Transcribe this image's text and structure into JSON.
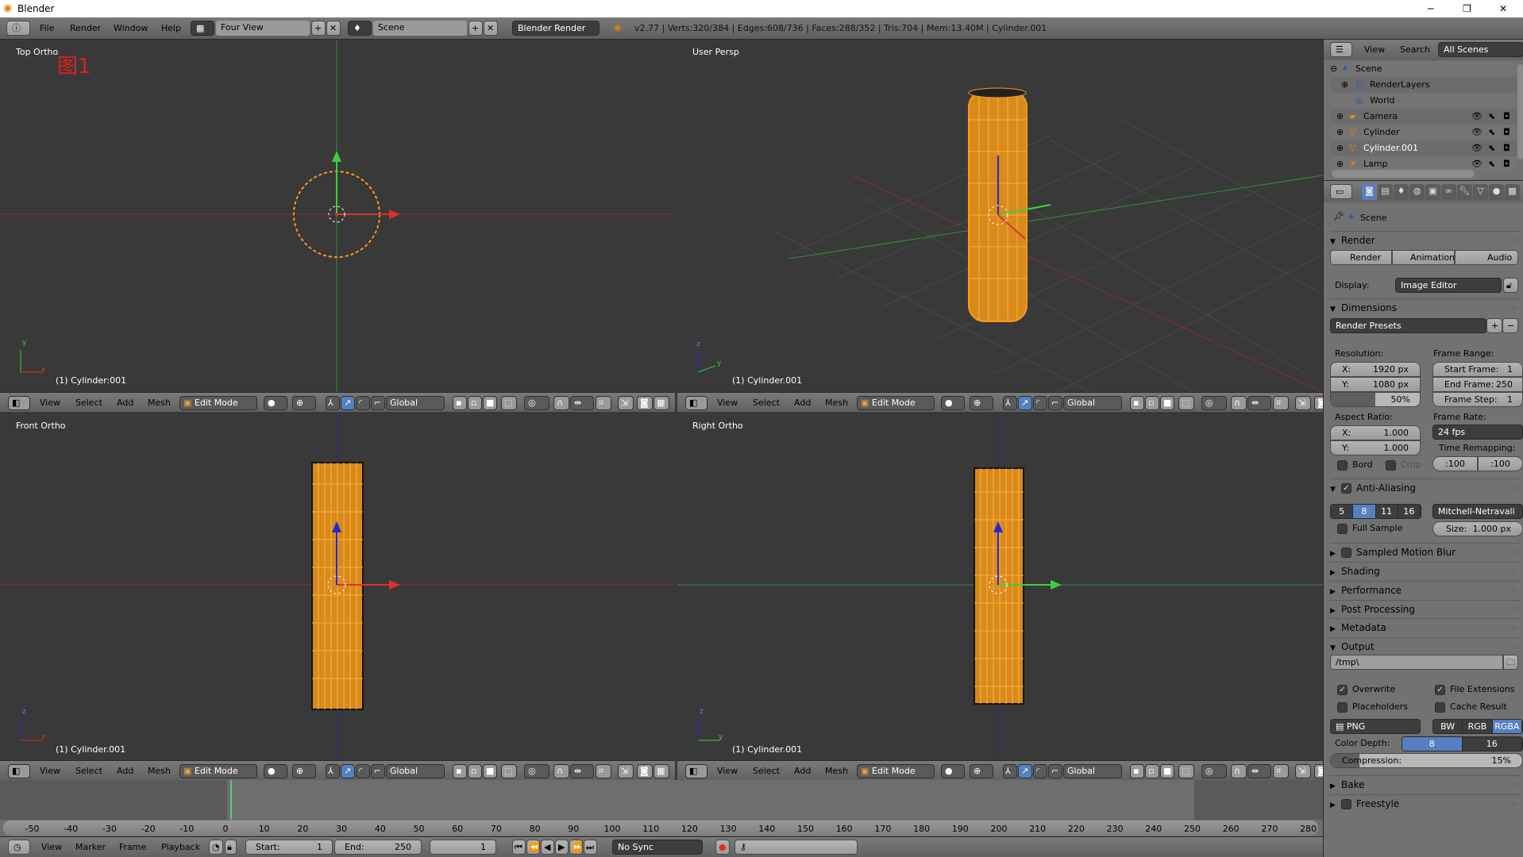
{
  "window": {
    "title": "Blender",
    "minimize": "─",
    "maximize": "❐",
    "close": "✕"
  },
  "topbar": {
    "menus": [
      "File",
      "Render",
      "Window",
      "Help"
    ],
    "screen_layout": "Four View",
    "scene": "Scene",
    "engine": "Blender Render",
    "stats": "v2.77 | Verts:320/384 | Edges:608/736 | Faces:288/352 | Tris:704 | Mem:13.40M | Cylinder.001"
  },
  "viewports": [
    {
      "name": "Top Ortho",
      "object": "(1) Cylinder:001",
      "annotation": "图1",
      "axes": [
        "y",
        "x"
      ]
    },
    {
      "name": "User Persp",
      "object": "(1) Cylinder.001",
      "axes": [
        "z",
        "y"
      ]
    },
    {
      "name": "Front Ortho",
      "object": "(1) Cylinder.001",
      "axes": [
        "z",
        "x"
      ]
    },
    {
      "name": "Right Ortho",
      "object": "(1) Cylinder.001",
      "axes": [
        "z",
        "y"
      ]
    }
  ],
  "viewport_header": {
    "menus": [
      "View",
      "Select",
      "Add",
      "Mesh"
    ],
    "mode": "Edit Mode",
    "orientation": "Global"
  },
  "colors": {
    "x_axis": "#c83030",
    "y_axis": "#3cb43c",
    "z_axis": "#2828d0",
    "mesh": "#ff9a1a",
    "active_blue": "#5680c2"
  },
  "timeline": {
    "ticks": [
      -50,
      -40,
      -30,
      -20,
      -10,
      0,
      10,
      20,
      30,
      40,
      50,
      60,
      70,
      80,
      90,
      100,
      110,
      120,
      130,
      140,
      150,
      160,
      170,
      180,
      190,
      200,
      210,
      220,
      230,
      240,
      250,
      260,
      270,
      280
    ],
    "current_frame": 1,
    "menus": [
      "View",
      "Marker",
      "Frame",
      "Playback"
    ],
    "start_label": "Start:",
    "start": "1",
    "end_label": "End:",
    "end": "250",
    "frame": "1",
    "sync": "No Sync"
  },
  "outliner": {
    "menus": [
      "View",
      "Search"
    ],
    "filter": "All Scenes",
    "items": [
      {
        "label": "Scene",
        "icon": "scene-icon"
      },
      {
        "label": "RenderLayers",
        "icon": "renderlayers-icon"
      },
      {
        "label": "World",
        "icon": "world-icon"
      },
      {
        "label": "Camera",
        "icon": "camera-icon"
      },
      {
        "label": "Cylinder",
        "icon": "mesh-icon"
      },
      {
        "label": "Cylinder.001",
        "icon": "mesh-icon",
        "selected": true
      },
      {
        "label": "Lamp",
        "icon": "lamp-icon"
      }
    ]
  },
  "properties": {
    "context": "Scene",
    "render": {
      "title": "Render",
      "render_btn": "Render",
      "animation_btn": "Animation",
      "audio_btn": "Audio",
      "display_label": "Display:",
      "display": "Image Editor"
    },
    "dimensions": {
      "title": "Dimensions",
      "presets": "Render Presets",
      "resolution_label": "Resolution:",
      "res_x_label": "X:",
      "res_x": "1920 px",
      "res_y_label": "Y:",
      "res_y": "1080 px",
      "res_pct": "50%",
      "res_pct_value": 50,
      "frame_range_label": "Frame Range:",
      "start_label": "Start Frame:",
      "start": "1",
      "end_label": "End Frame:",
      "end": "250",
      "step_label": "Frame Step:",
      "step": "1",
      "aspect_label": "Aspect Ratio:",
      "asp_x_label": "X:",
      "asp_x": "1.000",
      "asp_y_label": "Y:",
      "asp_y": "1.000",
      "frame_rate_label": "Frame Rate:",
      "frame_rate": "24 fps",
      "time_remap_label": "Time Remapping:",
      "remap_old": ":100",
      "remap_new": ":100",
      "bord": "Bord",
      "crop": "Crop"
    },
    "anti_aliasing": {
      "title": "Anti-Aliasing",
      "samples": [
        "5",
        "8",
        "11",
        "16"
      ],
      "active_sample": "8",
      "filter": "Mitchell-Netravali",
      "full_sample": "Full Sample",
      "size_label": "Size:",
      "size": "1.000 px"
    },
    "collapsed": [
      "Sampled Motion Blur",
      "Shading",
      "Performance",
      "Post Processing",
      "Metadata"
    ],
    "output": {
      "title": "Output",
      "path": "/tmp\\",
      "overwrite": "Overwrite",
      "file_extensions": "File Extensions",
      "placeholders": "Placeholders",
      "cache_result": "Cache Result",
      "format": "PNG",
      "color_modes": [
        "BW",
        "RGB",
        "RGBA"
      ],
      "active_color_mode": "RGBA",
      "color_depth_label": "Color Depth:",
      "depths": [
        "8",
        "16"
      ],
      "active_depth": "8",
      "compression_label": "Compression:",
      "compression": "15%",
      "compression_value": 15
    },
    "bake": "Bake",
    "freestyle": "Freestyle"
  }
}
